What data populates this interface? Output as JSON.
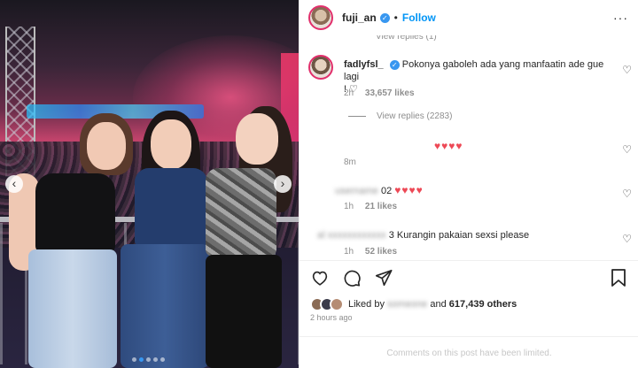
{
  "post": {
    "username": "fuji_an",
    "separator": "•",
    "follow_label": "Follow",
    "more_label": "···",
    "carousel_dots": 5,
    "active_dot": 2
  },
  "faded_line": "View replies (1)",
  "comments": [
    {
      "username": "fadlyfsl_",
      "text": "Pokonya gaboleh ada yang manfaatin ade gue lagi",
      "text2": "! ♡",
      "time": "2h",
      "likes": "33,657 likes",
      "view_replies": "View replies (2283)"
    },
    {
      "text": "♥♥♥♥",
      "time": "8m"
    },
    {
      "username_blurred": "username",
      "text_suffix": "02",
      "hearts": "♥♥♥♥",
      "time": "1h",
      "likes": "21 likes"
    },
    {
      "username_blurred": "al",
      "text_prefix": "3",
      "text": "Kurangin pakaian sexsi please",
      "time": "1h",
      "likes": "52 likes"
    }
  ],
  "likes": {
    "prefix": "Liked by",
    "name_blurred": "someone",
    "and": "and",
    "count": "617,439 others"
  },
  "timestamp": "2 hours ago",
  "limited_text": "Comments on this post have been limited.",
  "colors": {
    "accent": "#0095f6",
    "heart_red": "#ed4956",
    "verified": "#3897f0"
  }
}
